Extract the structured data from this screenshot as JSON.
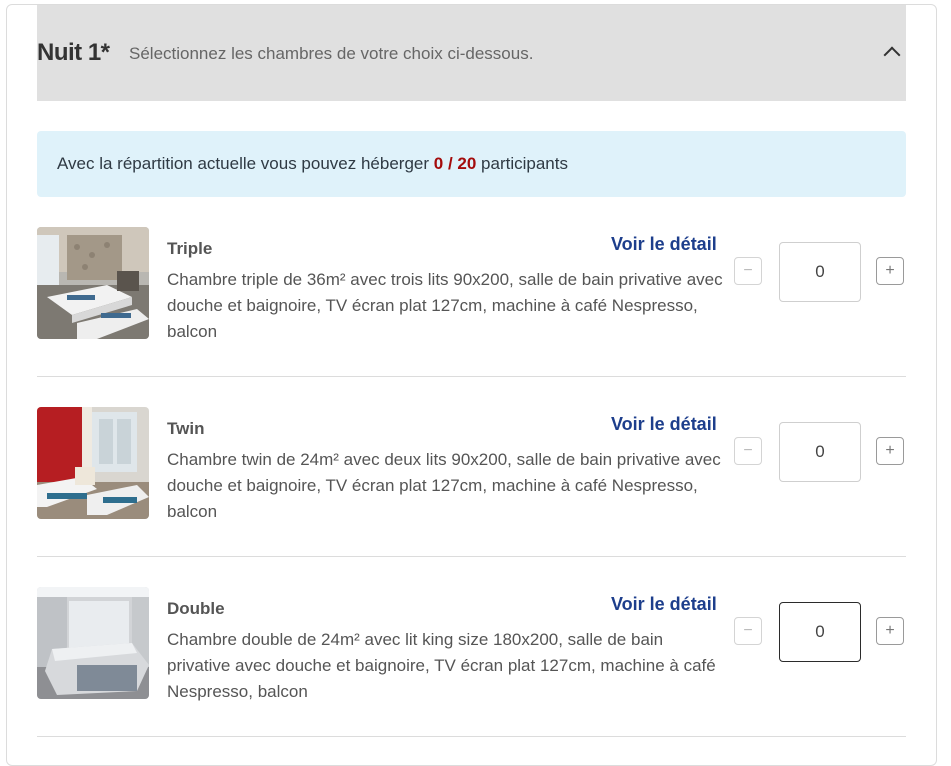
{
  "night": {
    "title": "Nuit 1*",
    "subtitle": "Sélectionnez les chambres de votre choix ci-dessous."
  },
  "info": {
    "prefix": "Avec la répartition actuelle vous pouvez héberger",
    "count": "0 / 20",
    "suffix": "participants"
  },
  "rooms": [
    {
      "name": "Triple",
      "description": "Chambre triple de 36m² avec trois lits 90x200, salle de bain privative avec douche et baignoire, TV écran plat 127cm, machine à café Nespresso, balcon",
      "detail_link": "Voir le détail",
      "minus": "−",
      "plus": "+",
      "quantity": "0"
    },
    {
      "name": "Twin",
      "description": "Chambre twin de 24m² avec deux lits 90x200, salle de bain privative avec douche et baignoire, TV écran plat 127cm, machine à café Nespresso, balcon",
      "detail_link": "Voir le détail",
      "minus": "−",
      "plus": "+",
      "quantity": "0"
    },
    {
      "name": "Double",
      "description": "Chambre double de 24m² avec lit king size 180x200, salle de bain privative avec douche et baignoire, TV écran plat 127cm, machine à café Nespresso, balcon",
      "detail_link": "Voir le détail",
      "minus": "−",
      "plus": "+",
      "quantity": "0"
    }
  ],
  "colors": {
    "header_bg": "#e0e0e0",
    "info_bg": "#dff2fa",
    "count_color": "#a40c0c",
    "link_color": "#1d3e8c"
  }
}
